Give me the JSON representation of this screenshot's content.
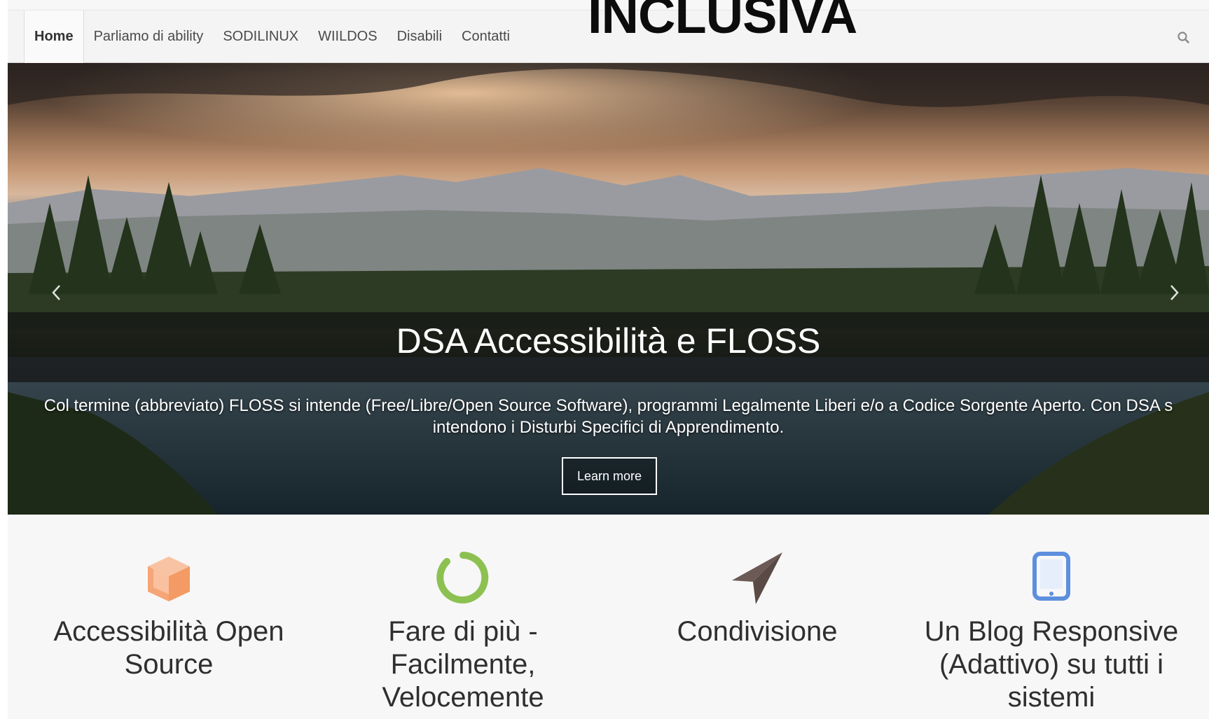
{
  "brand": {
    "title": "INCLUSIVA"
  },
  "nav": {
    "items": [
      {
        "label": "Home",
        "active": true
      },
      {
        "label": "Parliamo di ability",
        "active": false
      },
      {
        "label": "SODILINUX",
        "active": false
      },
      {
        "label": "WIILDOS",
        "active": false
      },
      {
        "label": "Disabili",
        "active": false
      },
      {
        "label": "Contatti",
        "active": false
      }
    ],
    "search_icon": "search-icon"
  },
  "slider": {
    "title": "DSA Accessibilità e FLOSS",
    "description_line1": "Col termine (abbreviato) FLOSS si intende (Free/Libre/Open Source Software), programmi Legalmente Liberi e/o a Codice Sorgente Aperto. Con DSA s",
    "description_line2": "intendono i Disturbi Specifici di Apprendimento.",
    "button_label": "Learn more",
    "prev_icon": "chevron-left-icon",
    "next_icon": "chevron-right-icon"
  },
  "features": [
    {
      "icon": "cube-icon",
      "color": "#f5a576",
      "title_lines": [
        "Accessibilità Open",
        "Source"
      ]
    },
    {
      "icon": "circle-notch-icon",
      "color": "#8cc152",
      "title_lines": [
        "Fare di più -",
        "Facilmente,",
        "Velocemente"
      ]
    },
    {
      "icon": "paper-plane-icon",
      "color": "#6b5a55",
      "title_lines": [
        "Condivisione"
      ]
    },
    {
      "icon": "tablet-icon",
      "color": "#5d8fdd",
      "title_lines": [
        "Un Blog Responsive",
        "(Adattivo) su tutti i",
        "sistemi"
      ]
    }
  ]
}
